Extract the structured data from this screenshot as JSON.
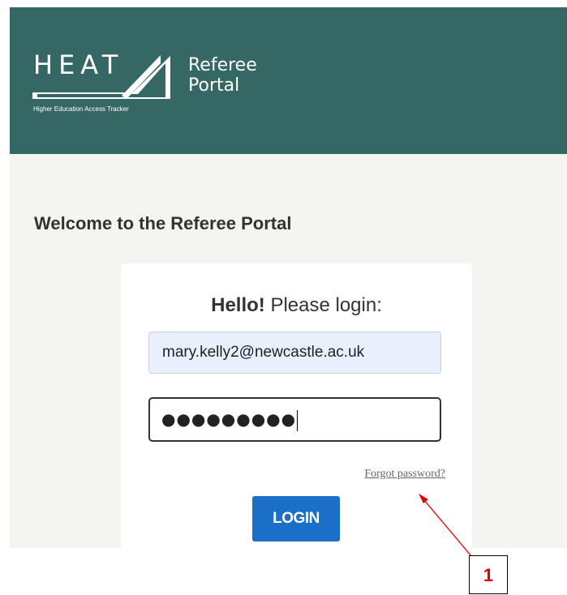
{
  "header": {
    "logo_text": "HEAT",
    "logo_subtitle": "Higher Education Access Tracker",
    "portal_line1": "Referee",
    "portal_line2": "Portal",
    "bg_color": "#356865"
  },
  "main": {
    "welcome_title": "Welcome to the Referee Portal",
    "login_card": {
      "hello_bold": "Hello!",
      "hello_rest": " Please login:",
      "email_value": "mary.kelly2@newcastle.ac.uk",
      "password_masked": "●●●●●●●●●",
      "forgot_password_label": "Forgot password?",
      "login_button_label": "LOGIN",
      "login_button_color": "#1a6fc7"
    }
  },
  "annotation": {
    "callout_number": "1",
    "arrow_color": "#e00000"
  }
}
